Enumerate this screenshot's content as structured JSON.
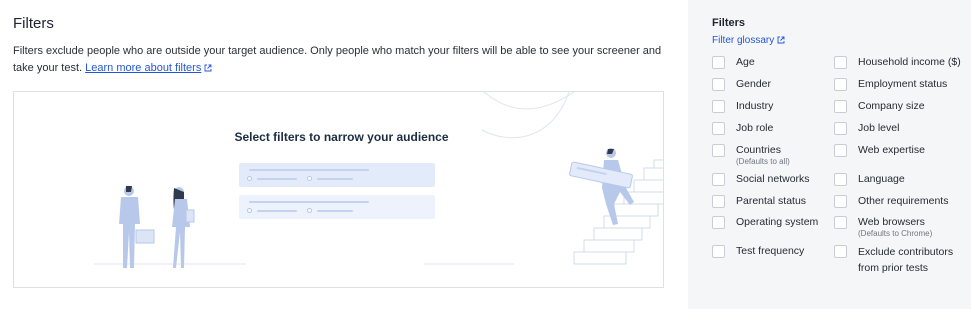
{
  "main": {
    "title": "Filters",
    "description": "Filters exclude people who are outside your target audience. Only people who match your filters will be able to see your screener and take your test.",
    "learn_more": "Learn more about filters",
    "illustration_title": "Select filters to narrow your audience"
  },
  "sidebar": {
    "title": "Filters",
    "glossary_link": "Filter glossary",
    "options": [
      {
        "label": "Age",
        "note": ""
      },
      {
        "label": "Household income ($)",
        "note": ""
      },
      {
        "label": "Gender",
        "note": ""
      },
      {
        "label": "Employment status",
        "note": ""
      },
      {
        "label": "Industry",
        "note": ""
      },
      {
        "label": "Company size",
        "note": ""
      },
      {
        "label": "Job role",
        "note": ""
      },
      {
        "label": "Job level",
        "note": ""
      },
      {
        "label": "Countries",
        "note": "(Defaults to all)"
      },
      {
        "label": "Web expertise",
        "note": ""
      },
      {
        "label": "Social networks",
        "note": ""
      },
      {
        "label": "Language",
        "note": ""
      },
      {
        "label": "Parental status",
        "note": ""
      },
      {
        "label": "Other requirements",
        "note": ""
      },
      {
        "label": "Operating system",
        "note": ""
      },
      {
        "label": "Web browsers",
        "note": "(Defaults to Chrome)"
      },
      {
        "label": "Test frequency",
        "note": ""
      },
      {
        "label": "Exclude contributors from prior tests",
        "note": ""
      }
    ]
  },
  "colors": {
    "link": "#2456d6",
    "panel_bg": "#f5f6f8",
    "illustration": "#b7c8ea"
  }
}
